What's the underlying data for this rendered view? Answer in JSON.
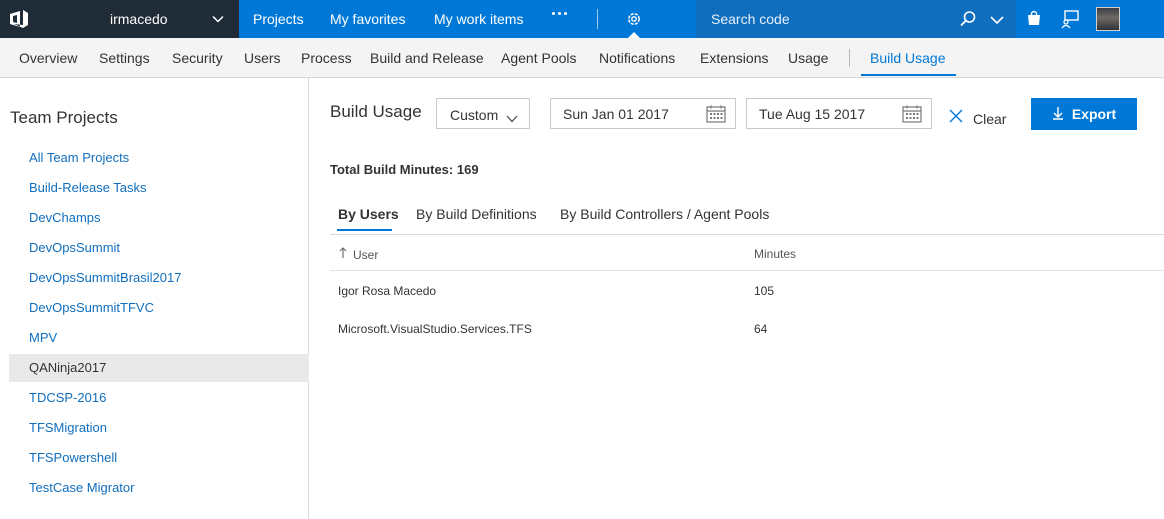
{
  "topbar": {
    "account_name": "irmacedo",
    "nav": [
      "Projects",
      "My favorites",
      "My work items"
    ],
    "search_placeholder": "Search code"
  },
  "subnav": {
    "tabs": [
      "Overview",
      "Settings",
      "Security",
      "Users",
      "Process",
      "Build and Release",
      "Agent Pools",
      "Notifications",
      "Extensions",
      "Usage"
    ],
    "active_tab": "Build Usage"
  },
  "left_panel": {
    "title": "Team Projects",
    "items": [
      "All Team Projects",
      "Build-Release Tasks",
      "DevChamps",
      "DevOpsSummit",
      "DevOpsSummitBrasil2017",
      "DevOpsSummitTFVC",
      "MPV",
      "QANinja2017",
      "TDCSP-2016",
      "TFSMigration",
      "TFSPowershell",
      "TestCase Migrator"
    ],
    "selected": "QANinja2017"
  },
  "main": {
    "title": "Build Usage",
    "range_select": "Custom",
    "start_date": "Sun Jan 01 2017",
    "end_date": "Tue Aug 15 2017",
    "clear_label": "Clear",
    "export_label": "Export",
    "total": "Total Build Minutes: 169",
    "tabs": [
      "By Users",
      "By Build Definitions",
      "By Build Controllers / Agent Pools"
    ],
    "table": {
      "columns": [
        "User",
        "Minutes"
      ],
      "rows": [
        [
          "Igor Rosa Macedo",
          "105"
        ],
        [
          "Microsoft.VisualStudio.Services.TFS",
          "64"
        ]
      ]
    }
  },
  "colors": {
    "accent": "#0078d7",
    "topbar_dark": "#1f2b36",
    "link": "#106ebe"
  }
}
